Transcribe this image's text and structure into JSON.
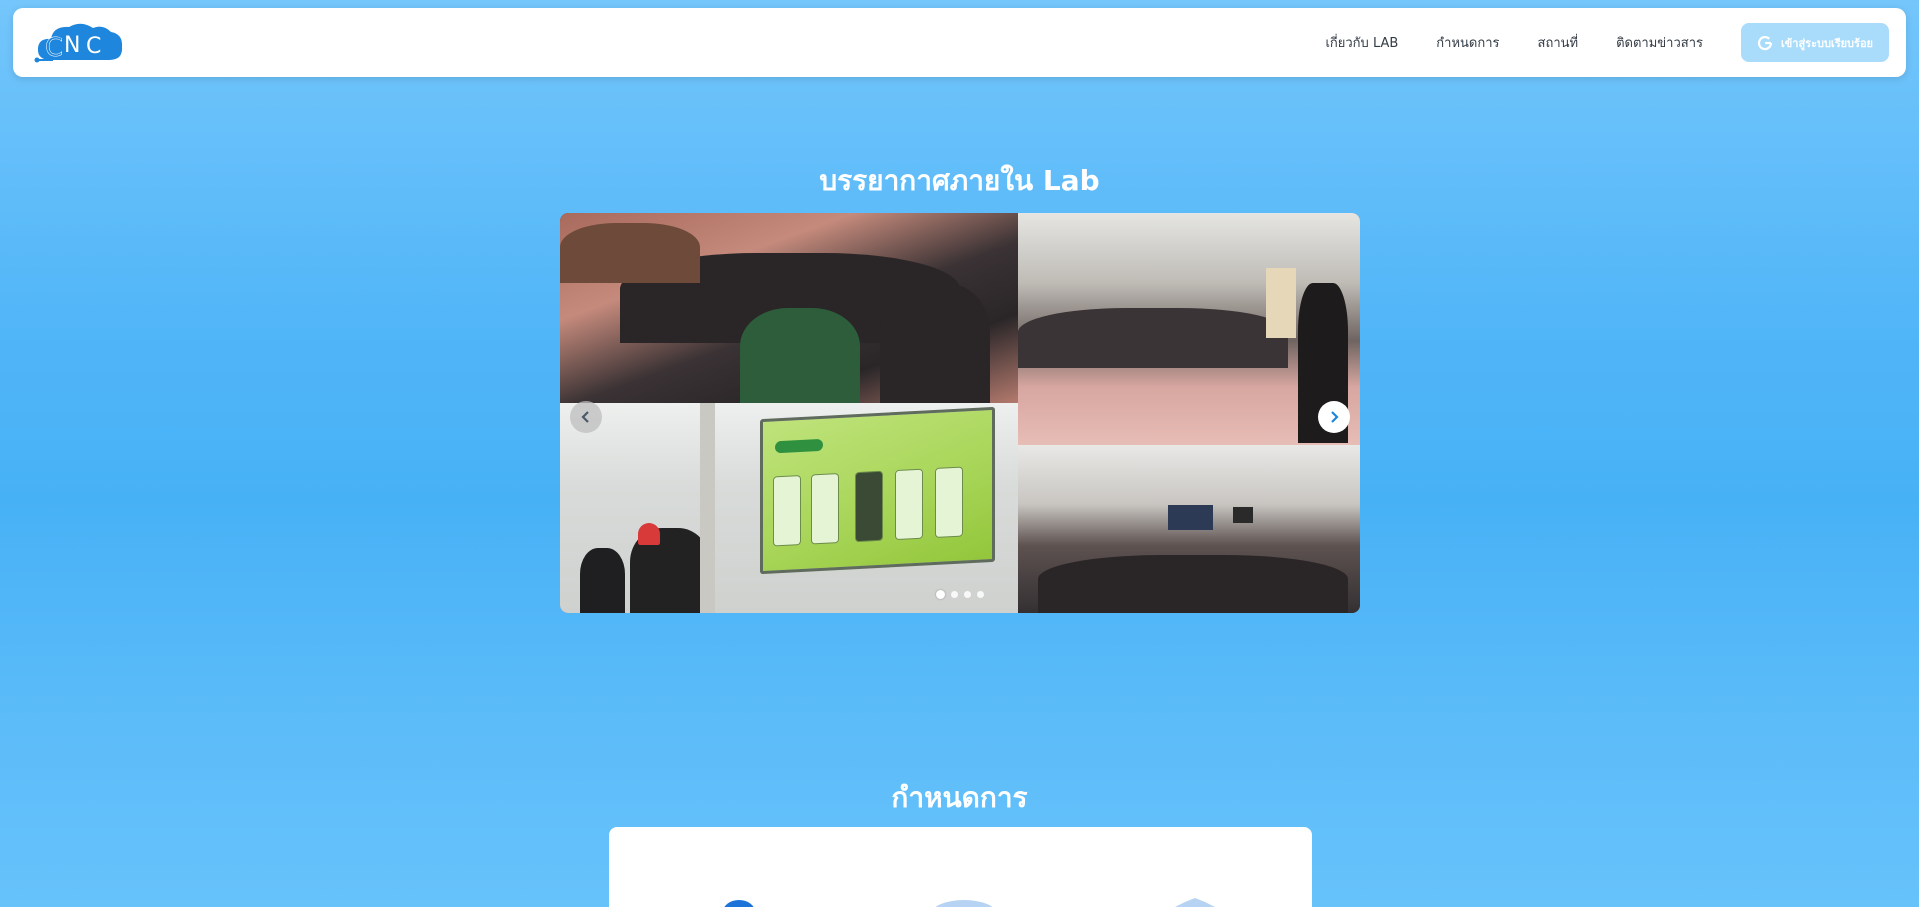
{
  "header": {
    "logo_text": "CNC",
    "nav": [
      {
        "label": "เกี่ยวกับ LAB"
      },
      {
        "label": "กำหนดการ"
      },
      {
        "label": "สถานที่"
      },
      {
        "label": "ติดตามข่าวสาร"
      }
    ],
    "login_label": "เข้าสู่ระบบเรียบร้อย",
    "login_icon": "google-icon"
  },
  "gallery": {
    "title": "บรรยากาศภายใน Lab",
    "photo_count": 4,
    "active_slide": 1,
    "slide_count": 4
  },
  "schedule": {
    "title": "กำหนดการ"
  },
  "colors": {
    "background": "#52b6f8",
    "accent": "#1e73d8",
    "login_button": "#a9dcfb"
  }
}
